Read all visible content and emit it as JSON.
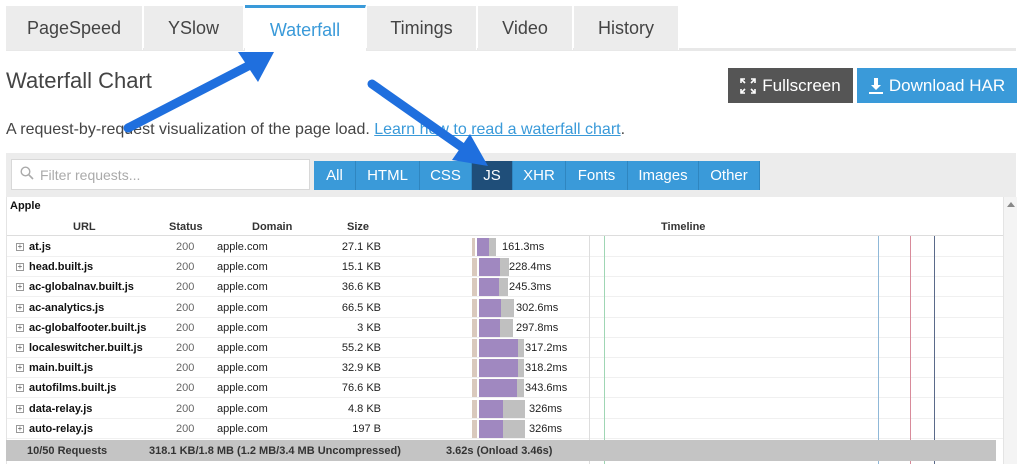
{
  "tabs": [
    {
      "label": "PageSpeed",
      "active": false
    },
    {
      "label": "YSlow",
      "active": false
    },
    {
      "label": "Waterfall",
      "active": true
    },
    {
      "label": "Timings",
      "active": false
    },
    {
      "label": "Video",
      "active": false
    },
    {
      "label": "History",
      "active": false
    }
  ],
  "header": {
    "title": "Waterfall Chart",
    "fullscreen_label": "Fullscreen",
    "download_label": "Download HAR",
    "description_prefix": "A request-by-request visualization of the page load.",
    "description_link": "Learn how to read a waterfall chart",
    "description_suffix": "."
  },
  "filter": {
    "placeholder": "Filter requests...",
    "buttons": [
      {
        "label": "All",
        "active": false
      },
      {
        "label": "HTML",
        "active": false
      },
      {
        "label": "CSS",
        "active": false
      },
      {
        "label": "JS",
        "active": true
      },
      {
        "label": "XHR",
        "active": false
      },
      {
        "label": "Fonts",
        "active": false
      },
      {
        "label": "Images",
        "active": false
      },
      {
        "label": "Other",
        "active": false
      }
    ]
  },
  "table": {
    "group": "Apple",
    "columns": {
      "url": "URL",
      "status": "Status",
      "domain": "Domain",
      "size": "Size",
      "timeline": "Timeline"
    },
    "rows": [
      {
        "url": "at.js",
        "status": "200",
        "domain": "apple.com",
        "size": "27.1 KB",
        "time": "161.3ms"
      },
      {
        "url": "head.built.js",
        "status": "200",
        "domain": "apple.com",
        "size": "15.1 KB",
        "time": "228.4ms"
      },
      {
        "url": "ac-globalnav.built.js",
        "status": "200",
        "domain": "apple.com",
        "size": "36.6 KB",
        "time": "245.3ms"
      },
      {
        "url": "ac-analytics.js",
        "status": "200",
        "domain": "apple.com",
        "size": "66.5 KB",
        "time": "302.6ms"
      },
      {
        "url": "ac-globalfooter.built.js",
        "status": "200",
        "domain": "apple.com",
        "size": "3 KB",
        "time": "297.8ms"
      },
      {
        "url": "localeswitcher.built.js",
        "status": "200",
        "domain": "apple.com",
        "size": "55.2 KB",
        "time": "317.2ms"
      },
      {
        "url": "main.built.js",
        "status": "200",
        "domain": "apple.com",
        "size": "32.9 KB",
        "time": "318.2ms"
      },
      {
        "url": "autofilms.built.js",
        "status": "200",
        "domain": "apple.com",
        "size": "76.6 KB",
        "time": "343.6ms"
      },
      {
        "url": "data-relay.js",
        "status": "200",
        "domain": "apple.com",
        "size": "4.8 KB",
        "time": "326ms"
      },
      {
        "url": "auto-relay.js",
        "status": "200",
        "domain": "apple.com",
        "size": "197 B",
        "time": "326ms"
      }
    ]
  },
  "footer": {
    "requests": "10/50 Requests",
    "size": "318.1 KB/1.8 MB  (1.2 MB/3.4 MB Uncompressed)",
    "onload": "3.62s  (Onload 3.46s)"
  },
  "colors": {
    "accent": "#3a9ad9",
    "active_filter": "#1f4e79",
    "dark_button": "#555555",
    "bar_wait": "#d9c9bd",
    "bar_receive": "#a088c0",
    "bar_other": "#c0c0c0"
  }
}
